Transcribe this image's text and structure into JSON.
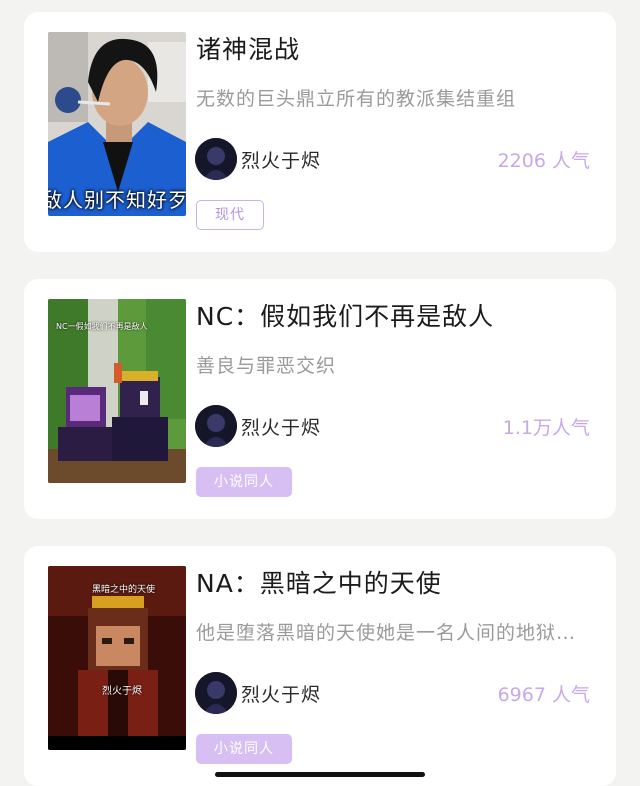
{
  "stories": [
    {
      "title": "诸神混战",
      "description": "无数的巨头鼎立所有的教派集结重组",
      "author": "烈火于烬",
      "popularity": "2206 人气",
      "tag": "现代",
      "tag_style": "outline",
      "cover_caption": "敌人别不知好歹"
    },
    {
      "title": "NC：假如我们不再是敌人",
      "description": "善良与罪恶交织",
      "author": "烈火于烬",
      "popularity": "1.1万人气",
      "tag": "小说同人",
      "tag_style": "filled",
      "cover_caption": "NC一假如我们不再是敌人"
    },
    {
      "title": "NA：黑暗之中的天使",
      "description": "他是堕落黑暗的天使她是一名人间的地狱…",
      "author": "烈火于烬",
      "popularity": "6967 人气",
      "tag": "小说同人",
      "tag_style": "filled",
      "cover_caption_top": "黑暗之中的天使",
      "cover_caption_bottom": "烈火于烬"
    }
  ],
  "colors": {
    "background": "#f3f3f1",
    "card": "#ffffff",
    "accent": "#c8a9e8",
    "tag_fill": "#d7bff3"
  }
}
